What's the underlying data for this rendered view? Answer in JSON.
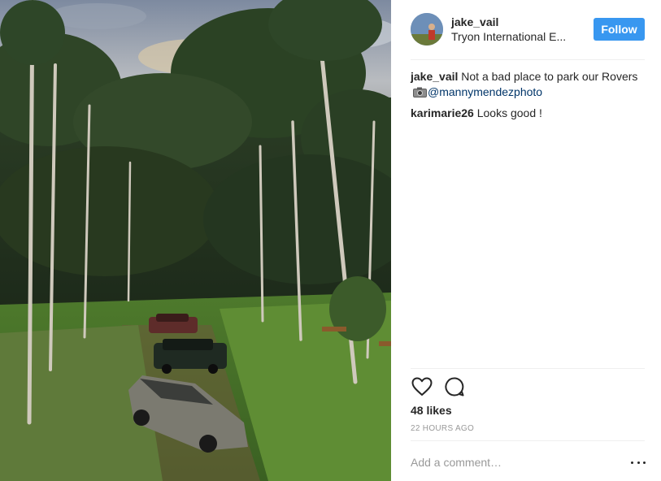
{
  "post": {
    "username": "jake_vail",
    "location": "Tryon International E...",
    "follow_label": "Follow"
  },
  "comments": [
    {
      "author": "jake_vail",
      "text": "Not a bad place to park our Rovers",
      "icon": "camera-icon",
      "mention": "@mannymendezphoto"
    },
    {
      "author": "karimarie26",
      "text": "Looks good !"
    }
  ],
  "actions": {
    "like_icon": "heart-icon",
    "comment_icon": "comment-icon"
  },
  "likes_label": "48 likes",
  "timestamp": "22 HOURS AGO",
  "comment_input": {
    "placeholder": "Add a comment…",
    "value": ""
  },
  "more_icon": "more-options-icon",
  "colors": {
    "follow_button": "#3897f0",
    "mention": "#003569",
    "muted": "#999999",
    "text": "#262626"
  }
}
